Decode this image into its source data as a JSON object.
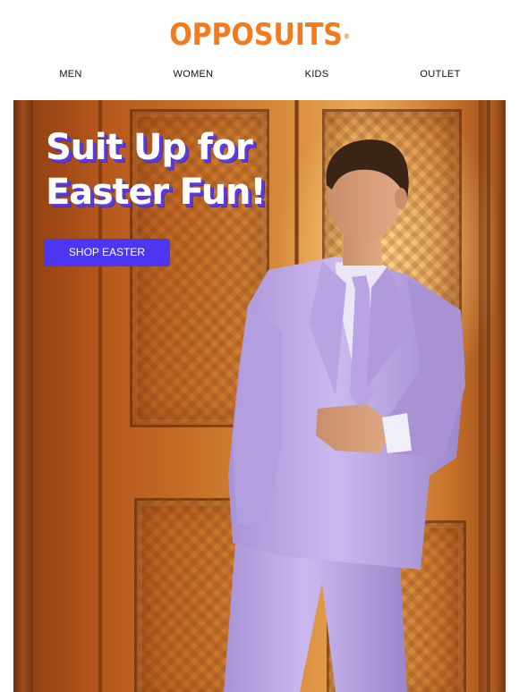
{
  "brand": {
    "logo_text": "OPPOSUITS",
    "logo_mark": "®",
    "color": "#f47a20"
  },
  "nav": {
    "items": [
      {
        "label": "MEN"
      },
      {
        "label": "WOMEN"
      },
      {
        "label": "KIDS"
      },
      {
        "label": "OUTLET"
      }
    ]
  },
  "hero": {
    "headline_line1": "Suit Up for",
    "headline_line2": "Easter Fun!",
    "cta_label": "SHOP EASTER",
    "cta_color": "#4d36f2",
    "headline_shadow_color": "#5a3cd8",
    "image": "man in lavender suit leaning against ornate wooden door",
    "suit_color": "#c7b4ea"
  }
}
